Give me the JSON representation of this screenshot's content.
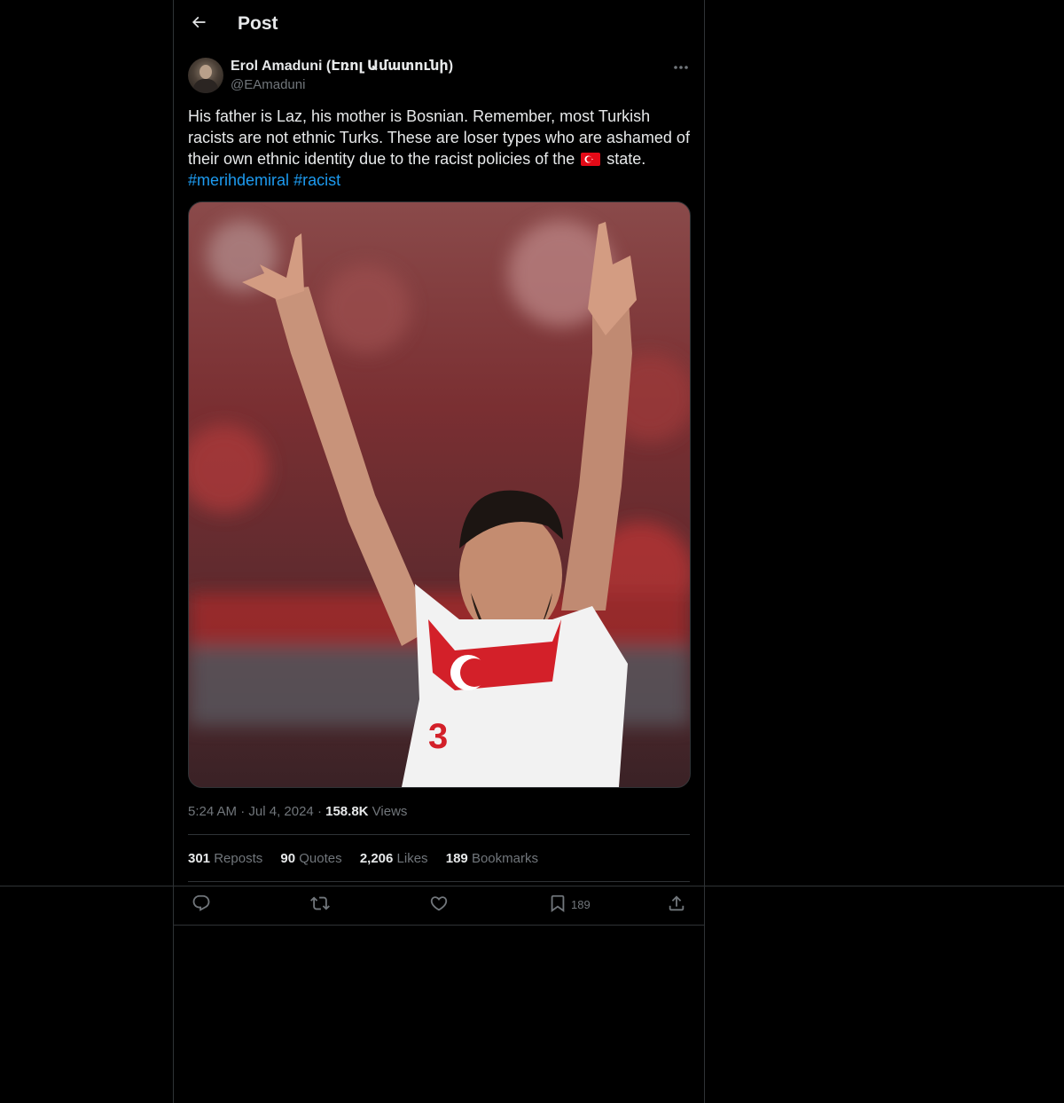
{
  "header": {
    "title": "Post",
    "back_icon": "arrow-left-icon"
  },
  "author": {
    "display_name": "Erol Amaduni (Էռոլ Ամատունի)",
    "handle": "@EAmaduni"
  },
  "post": {
    "text_part1": "His father is Laz, his mother is Bosnian. Remember, most Turkish racists are not ethnic Turks. These are loser types who are ashamed of their own ethnic identity due to the racist policies of the",
    "flag_icon": "turkey-flag-icon",
    "text_part2": "state.",
    "hashtags": [
      "#merihdemiral",
      "#racist"
    ],
    "media_description_icon": "photo"
  },
  "meta": {
    "time": "5:24 AM",
    "separator": "·",
    "date": "Jul 4, 2024",
    "views_count": "158.8K",
    "views_label": "Views"
  },
  "stats": {
    "reposts": {
      "count": "301",
      "label": "Reposts"
    },
    "quotes": {
      "count": "90",
      "label": "Quotes"
    },
    "likes": {
      "count": "2,206",
      "label": "Likes"
    },
    "bookmarks": {
      "count": "189",
      "label": "Bookmarks"
    }
  },
  "actions": {
    "reply_icon": "reply-icon",
    "repost_icon": "repost-icon",
    "like_icon": "heart-icon",
    "bookmark_icon": "bookmark-icon",
    "bookmark_count": "189",
    "share_icon": "share-icon"
  },
  "colors": {
    "background": "#000000",
    "text": "#e7e9ea",
    "muted": "#71767b",
    "link": "#1d9bf0",
    "border": "#2f3336"
  }
}
